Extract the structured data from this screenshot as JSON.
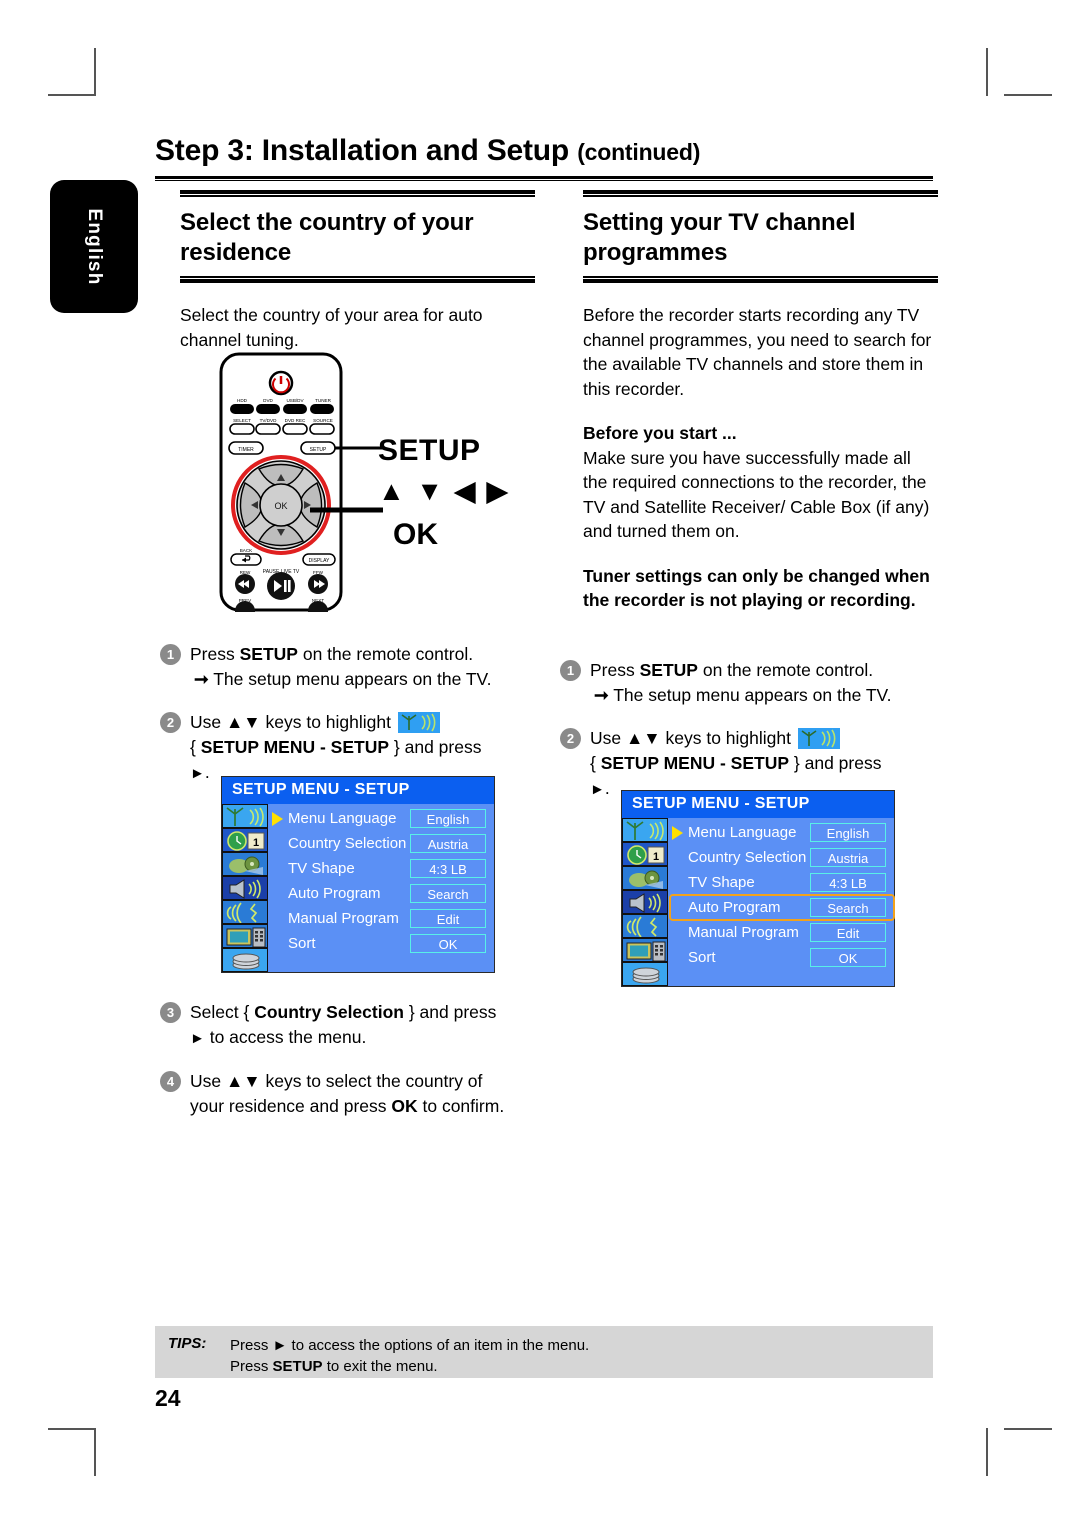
{
  "document": {
    "page_number": "24",
    "language_tab": "English",
    "title_main": "Step 3: Installation and Setup",
    "title_suffix": "(continued)"
  },
  "left_column": {
    "heading": "Select the country of your residence",
    "intro": "Select the country of your area for auto channel tuning.",
    "remote": {
      "callout_setup": "SETUP",
      "callout_arrows": "▲ ▼ ◀ ▶",
      "callout_ok": "OK",
      "buttons_row1": [
        "HDD",
        "DVD",
        "USB/DV",
        "TUNER"
      ],
      "buttons_row2": [
        "SELECT",
        "TV/DVD",
        "DVD REC",
        "SOURCE"
      ],
      "buttons_row3": [
        "TIMER",
        "SETUP"
      ],
      "center_ok": "OK",
      "buttons_row4": [
        "BACK",
        "DISPLAY"
      ],
      "buttons_row5": [
        "REW",
        "PAUSE LIVE TV",
        "FFW"
      ],
      "buttons_row6": [
        "PREV",
        "NEXT"
      ]
    },
    "steps": [
      {
        "num": "1",
        "text": "Press SETUP on the remote control.",
        "bold_parts": [
          "SETUP"
        ],
        "sub": "The setup menu appears on the TV."
      },
      {
        "num": "2",
        "text_before": "Use ▲▼ keys to highlight",
        "icon": "antenna-setup-icon",
        "text_after": "{ SETUP MENU - SETUP } and press ▶."
      },
      {
        "num": "3",
        "text": "Select { Country Selection } and press ▶ to access the menu.",
        "bold_parts": [
          "Country Selection"
        ]
      },
      {
        "num": "4",
        "text": "Use ▲▼ keys to select the country of your residence and press OK to confirm.",
        "bold_parts": [
          "OK"
        ]
      }
    ],
    "osd": {
      "title": "SETUP MENU - SETUP",
      "rows": [
        {
          "label": "Menu Language",
          "value": "English",
          "selected": false,
          "cursor": true
        },
        {
          "label": "Country Selection",
          "value": "Austria",
          "selected": false,
          "cursor": false
        },
        {
          "label": "TV Shape",
          "value": "4:3 LB",
          "selected": false,
          "cursor": false
        },
        {
          "label": "Auto Program",
          "value": "Search",
          "selected": false,
          "cursor": false
        },
        {
          "label": "Manual Program",
          "value": "Edit",
          "selected": false,
          "cursor": false
        },
        {
          "label": "Sort",
          "value": "OK",
          "selected": false,
          "cursor": false
        }
      ],
      "icons": [
        "antenna-icon",
        "clock-calendar-icon",
        "playback-icon",
        "speaker-icon",
        "signal-icon",
        "tv-remote-icon",
        "disc-icon"
      ]
    }
  },
  "right_column": {
    "heading": "Setting your TV channel programmes",
    "intro": "Before the recorder starts recording any TV channel programmes, you need to search for the available TV channels and store them in this recorder.",
    "before_you_start_title": "Before you start ...",
    "before_you_start_body": "Make sure you have successfully made all the required connections to the recorder, the TV and Satellite Receiver/ Cable Box (if any) and turned them on.",
    "note": "Tuner settings can only be changed when the recorder is not playing or recording.",
    "steps": [
      {
        "num": "1",
        "text": "Press SETUP on the remote control.",
        "bold_parts": [
          "SETUP"
        ],
        "sub": "The setup menu appears on the TV."
      },
      {
        "num": "2",
        "text_before": "Use ▲▼ keys to highlight",
        "icon": "antenna-setup-icon",
        "text_after": "{ SETUP MENU - SETUP } and press ▶."
      }
    ],
    "osd": {
      "title": "SETUP MENU - SETUP",
      "rows": [
        {
          "label": "Menu Language",
          "value": "English",
          "selected": false,
          "cursor": true
        },
        {
          "label": "Country Selection",
          "value": "Austria",
          "selected": false,
          "cursor": false
        },
        {
          "label": "TV Shape",
          "value": "4:3 LB",
          "selected": false,
          "cursor": false
        },
        {
          "label": "Auto Program",
          "value": "Search",
          "selected": true,
          "cursor": false
        },
        {
          "label": "Manual Program",
          "value": "Edit",
          "selected": false,
          "cursor": false
        },
        {
          "label": "Sort",
          "value": "OK",
          "selected": false,
          "cursor": false
        }
      ],
      "icons": [
        "antenna-icon",
        "clock-calendar-icon",
        "playback-icon",
        "speaker-icon",
        "signal-icon",
        "tv-remote-icon",
        "disc-icon"
      ]
    }
  },
  "tips": {
    "label": "TIPS:",
    "line1": "Press ▶ to access the options of an item in the menu.",
    "line2": "Press SETUP to exit the menu."
  },
  "colors": {
    "osd_title_bg": "#0b5ff0",
    "osd_body_bg": "#5b90f5",
    "osd_value_border": "#58f0e8",
    "osd_highlight": "#f2a21c",
    "osd_cursor": "#ffe000",
    "tips_bg": "#d6d6d6",
    "bullet_bg": "#8a8a8a",
    "remote_ring": "#e02020"
  }
}
